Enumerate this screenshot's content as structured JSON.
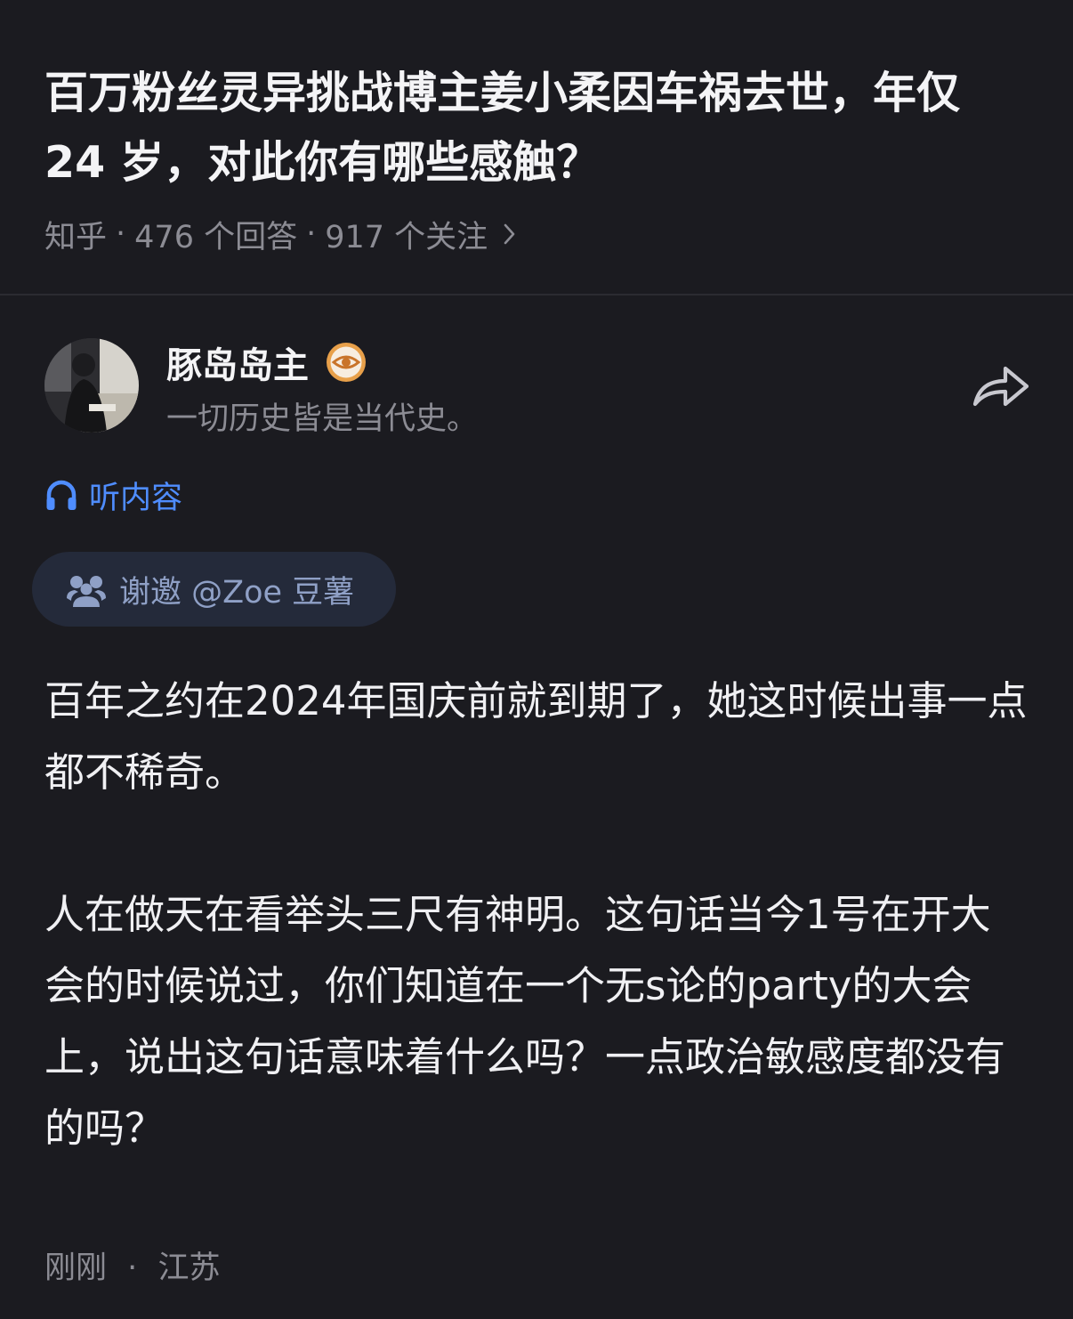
{
  "question": {
    "title": "百万粉丝灵异挑战博主姜小柔因车祸去世，年仅 24 岁，对此你有哪些感触？",
    "source": "知乎",
    "answers_count": "476 个回答",
    "followers_count": "917 个关注",
    "separator": "·"
  },
  "author": {
    "name": "豚岛岛主",
    "bio": "一切历史皆是当代史。",
    "badge_icon": "eye-badge-icon"
  },
  "listen": {
    "label": "听内容",
    "icon": "headphone-icon"
  },
  "invite": {
    "label": "谢邀 @Zoe 豆薯",
    "icon": "people-icon"
  },
  "answer": {
    "paragraphs": [
      "百年之约在2024年国庆前就到期了，她这时候出事一点都不稀奇。",
      "人在做天在看举头三尺有神明。这句话当今1号在开大会的时候说过，你们知道在一个无s论的party的大会上，说出这句话意味着什么吗？一点政治敏感度都没有的吗？"
    ],
    "time": "刚刚",
    "location": "江苏",
    "separator": "·"
  },
  "colors": {
    "background": "#1b1b20",
    "accent_blue": "#4f8dff",
    "muted_text": "#8c8c94",
    "chip_background": "#242a3a"
  }
}
